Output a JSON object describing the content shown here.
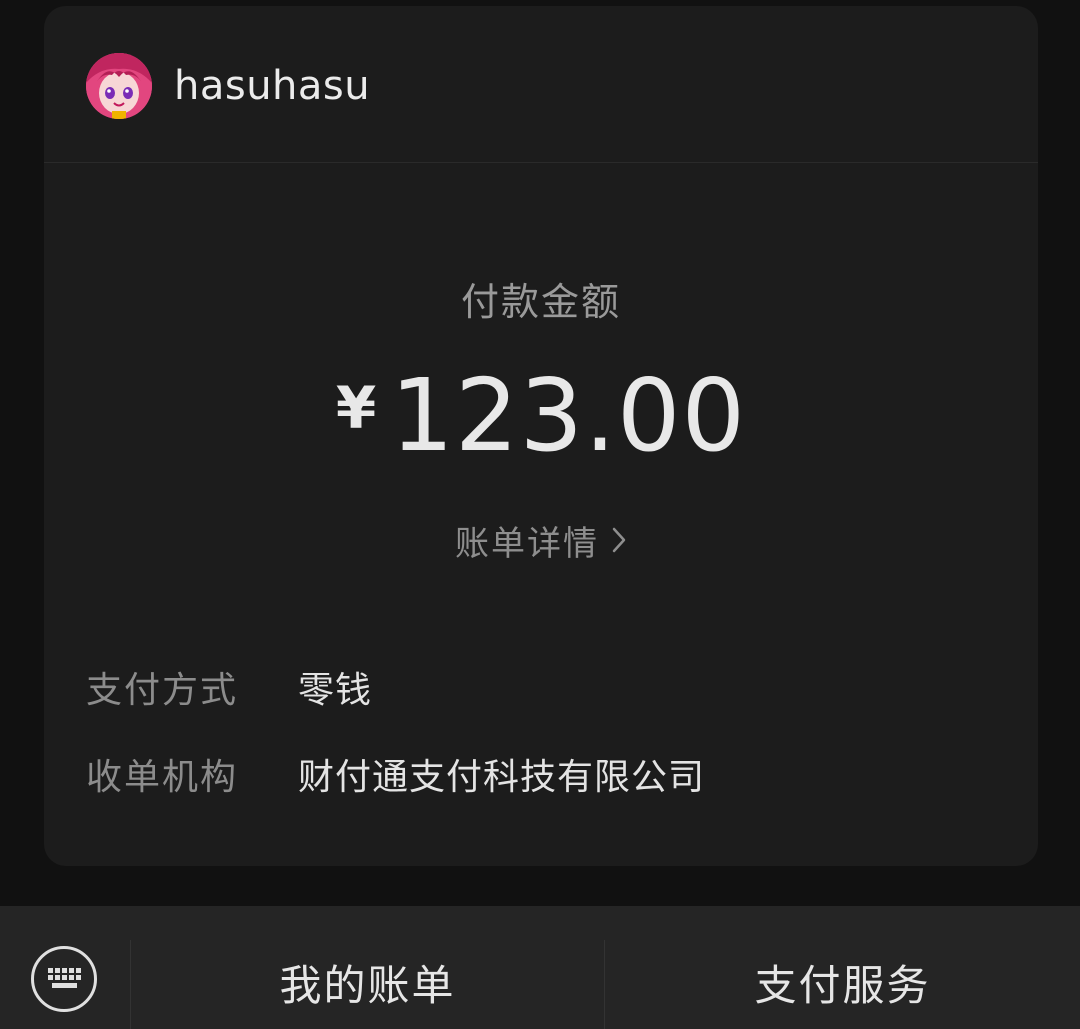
{
  "header": {
    "username": "hasuhasu",
    "avatar_icon": "anime-avatar-icon"
  },
  "payment": {
    "amount_label": "付款金额",
    "currency_symbol": "¥",
    "amount": "123.00",
    "bill_detail_label": "账单详情"
  },
  "info": [
    {
      "label": "支付方式",
      "value": "零钱"
    },
    {
      "label": "收单机构",
      "value": "财付通支付科技有限公司"
    }
  ],
  "bottom_bar": {
    "keyboard_icon": "keyboard-icon",
    "items": [
      {
        "label": "我的账单"
      },
      {
        "label": "支付服务"
      }
    ]
  },
  "colors": {
    "background": "#111111",
    "card": "#1c1c1c",
    "bottom_bar": "#252525",
    "avatar_accent": "#d93a7a"
  }
}
